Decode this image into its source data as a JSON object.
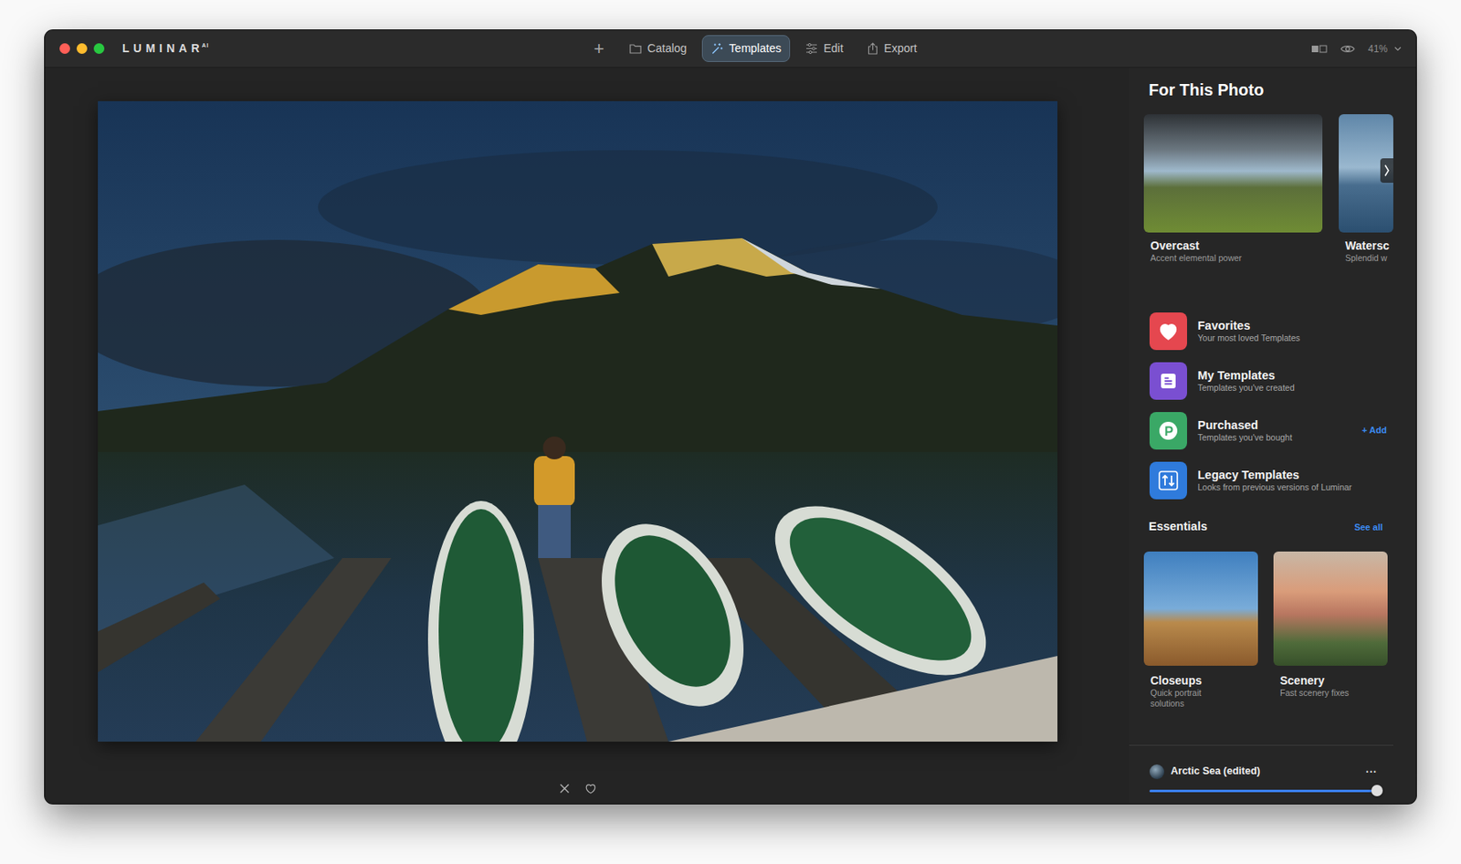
{
  "window": {
    "title": "LUMINAR",
    "badge": "AI"
  },
  "toolbar": {
    "add": "+",
    "tabs": [
      {
        "label": "Catalog",
        "selected": false
      },
      {
        "label": "Templates",
        "selected": true
      },
      {
        "label": "Edit",
        "selected": false
      },
      {
        "label": "Export",
        "selected": false
      }
    ],
    "zoom": "41%"
  },
  "viewer": {
    "favorite": false
  },
  "panel": {
    "heading": "For This Photo",
    "suggestions": [
      {
        "title": "Overcast",
        "subtitle": "Accent elemental power"
      },
      {
        "title": "Watersc",
        "subtitle": "Splendid w"
      }
    ],
    "collections": [
      {
        "title": "Favorites",
        "subtitle": "Your most loved Templates",
        "color": "#e5474f"
      },
      {
        "title": "My Templates",
        "subtitle": "Templates you've created",
        "color": "#7a4fd1"
      },
      {
        "title": "Purchased",
        "subtitle": "Templates you've bought",
        "color": "#3aa866",
        "action": "+ Add"
      },
      {
        "title": "Legacy Templates",
        "subtitle": "Looks from previous versions of Luminar",
        "color": "#2f7bdc"
      }
    ],
    "essentials": {
      "title": "Essentials",
      "link": "See all",
      "items": [
        {
          "title": "Closeups",
          "subtitle": "Quick portrait solutions"
        },
        {
          "title": "Scenery",
          "subtitle": "Fast scenery fixes"
        }
      ]
    },
    "applied": {
      "name": "Arctic Sea (edited)",
      "menu": "···",
      "level": 0.98
    }
  }
}
